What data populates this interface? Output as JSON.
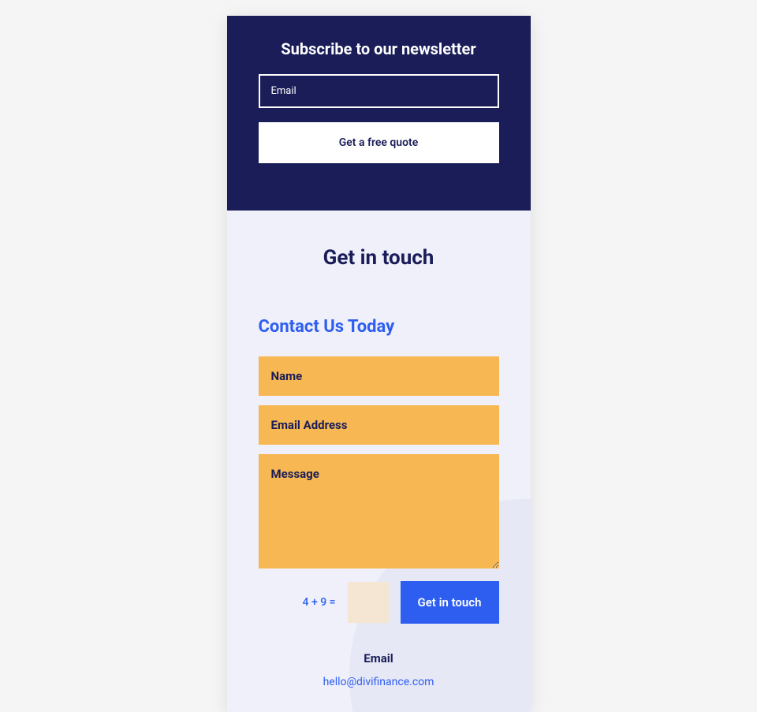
{
  "newsletter": {
    "title": "Subscribe to our newsletter",
    "email_placeholder": "Email",
    "button_label": "Get a free quote"
  },
  "contact": {
    "section_title": "Get in touch",
    "form_title": "Contact Us Today",
    "name_placeholder": "Name",
    "email_placeholder": "Email Address",
    "message_placeholder": "Message",
    "captcha_question": "4 + 9 =",
    "submit_label": "Get in touch",
    "info_label": "Email",
    "info_email": "hello@divifinance.com"
  }
}
